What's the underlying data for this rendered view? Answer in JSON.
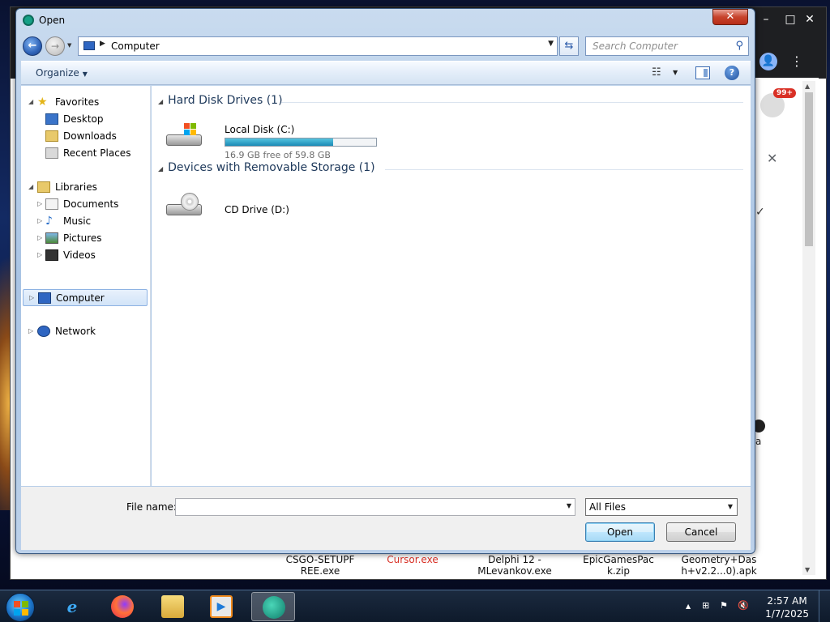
{
  "background": {
    "files": [
      {
        "name": "CSGO-SETUPF\nREE.exe",
        "color": "#111111"
      },
      {
        "name": "Cursor.exe",
        "color": "#d93025"
      },
      {
        "name": "Delphi 12 -\nMLevankov.exe",
        "color": "#111111"
      },
      {
        "name": "EpicGamesPac\nk.zip",
        "color": "#111111"
      },
      {
        "name": "Geometry+Das\nh+v2.2...0).apk",
        "color": "#111111"
      }
    ],
    "notification_badge": "99+",
    "partial_letter": "a"
  },
  "dialog": {
    "title": "Open",
    "address": {
      "location": "Computer"
    },
    "search": {
      "placeholder": "Search Computer"
    },
    "toolbar": {
      "organize": "Organize"
    },
    "nav": {
      "favorites": {
        "label": "Favorites",
        "items": [
          "Desktop",
          "Downloads",
          "Recent Places"
        ]
      },
      "libraries": {
        "label": "Libraries",
        "items": [
          "Documents",
          "Music",
          "Pictures",
          "Videos"
        ]
      },
      "computer": {
        "label": "Computer"
      },
      "network": {
        "label": "Network"
      }
    },
    "groups": [
      {
        "header": "Hard Disk Drives (1)"
      },
      {
        "header": "Devices with Removable Storage (1)"
      }
    ],
    "drives": {
      "local": {
        "name": "Local Disk (C:)",
        "free_text": "16.9 GB free of 59.8 GB",
        "used_fraction": 0.717
      },
      "cd": {
        "name": "CD Drive (D:)"
      }
    },
    "bottom": {
      "file_name_label": "File name:",
      "file_name_value": "",
      "filter_selected": "All Files",
      "open_label": "Open",
      "cancel_label": "Cancel"
    }
  },
  "taskbar": {
    "apps": [
      "internet-explorer",
      "firefox",
      "windows-explorer",
      "media-player",
      "cursor-app"
    ],
    "clock": {
      "time": "2:57 AM",
      "date": "1/7/2025"
    }
  }
}
